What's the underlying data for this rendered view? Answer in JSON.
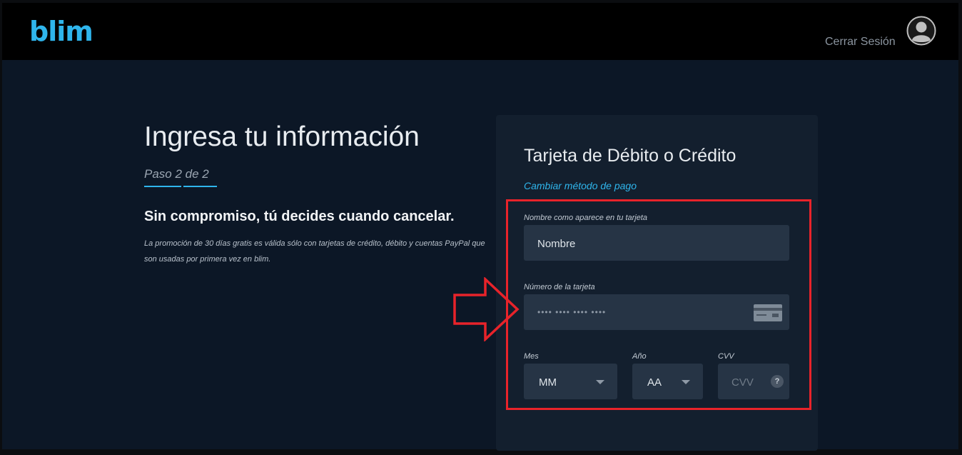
{
  "header": {
    "logo": "blim",
    "logout_label": "Cerrar Sesión"
  },
  "intro": {
    "title": "Ingresa tu información",
    "step": "Paso 2 de 2",
    "headline": "Sin compromiso, tú decides cuando cancelar.",
    "promo": "La promoción de 30 días gratis es válida sólo con tarjetas de crédito, débito y cuentas PayPal que son usadas por primera vez en blim."
  },
  "payment": {
    "title": "Tarjeta de Débito o Crédito",
    "change_method": "Cambiar método de pago",
    "name_label": "Nombre como aparece en tu tarjeta",
    "name_placeholder": "Nombre",
    "number_label": "Número de la tarjeta",
    "number_placeholder": "•••• •••• •••• ••••",
    "month_label": "Mes",
    "month_value": "MM",
    "year_label": "Año",
    "year_value": "AA",
    "cvv_label": "CVV",
    "cvv_placeholder": "CVV",
    "cvv_help": "?"
  },
  "colors": {
    "accent": "#2fb5ec",
    "highlight": "#e8232a",
    "background": "#0c1726"
  },
  "icons": {
    "avatar": "user-avatar-icon",
    "card": "credit-card-icon",
    "dropdown": "chevron-down-icon",
    "annotation": "arrow-right-icon"
  }
}
